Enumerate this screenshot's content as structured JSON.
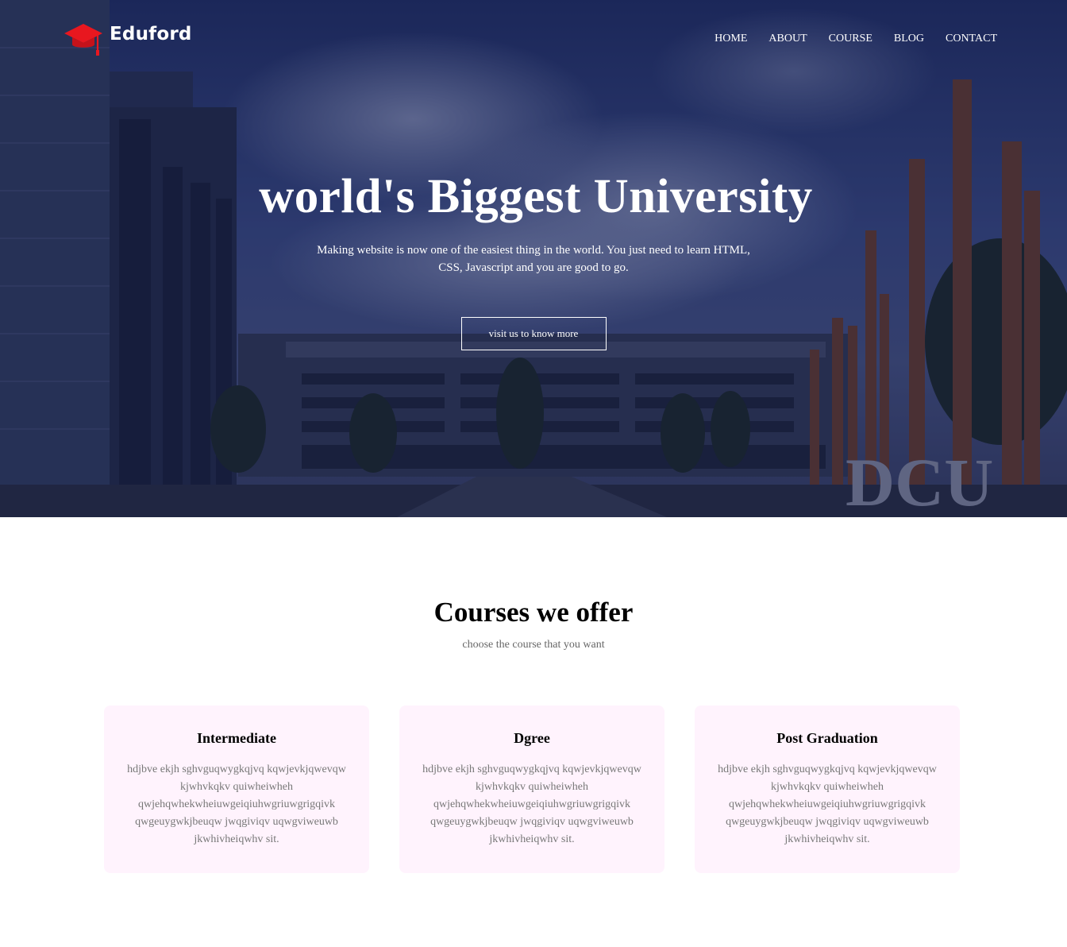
{
  "brand": {
    "name": "Eduford",
    "logo_icon": "graduation-cap-icon",
    "logo_color": "#e8171f"
  },
  "nav": {
    "items": [
      {
        "label": "HOME"
      },
      {
        "label": "ABOUT"
      },
      {
        "label": "COURSE"
      },
      {
        "label": "BLOG"
      },
      {
        "label": "CONTACT"
      }
    ]
  },
  "hero": {
    "title": "world's Biggest University",
    "subtitle": "Making website is now one of the easiest thing in the world. You just need to learn HTML, CSS, Javascript and you are good to go.",
    "button_label": "visit us to know more",
    "background_sign": "DCU",
    "overlay_color": "#0e184a"
  },
  "courses": {
    "title": "Courses we offer",
    "subtitle": "choose the course that you want",
    "card_bg": "#fff3fd",
    "items": [
      {
        "title": "Intermediate",
        "text": "hdjbve ekjh sghvguqwygkqjvq kqwjevkjqwevqw kjwhvkqkv quiwheiwheh qwjehqwhekwheiuwgeiqiuhwgriuwgrigqivk qwgeuygwkjbeuqw jwqgiviqv uqwgviweuwb jkwhivheiqwhv sit."
      },
      {
        "title": "Dgree",
        "text": "hdjbve ekjh sghvguqwygkqjvq kqwjevkjqwevqw kjwhvkqkv quiwheiwheh qwjehqwhekwheiuwgeiqiuhwgriuwgrigqivk qwgeuygwkjbeuqw jwqgiviqv uqwgviweuwb jkwhivheiqwhv sit."
      },
      {
        "title": "Post Graduation",
        "text": "hdjbve ekjh sghvguqwygkqjvq kqwjevkjqwevqw kjwhvkqkv quiwheiwheh qwjehqwhekwheiuwgeiqiuhwgriuwgrigqivk qwgeuygwkjbeuqw jwqgiviqv uqwgviweuwb jkwhivheiqwhv sit."
      }
    ]
  }
}
